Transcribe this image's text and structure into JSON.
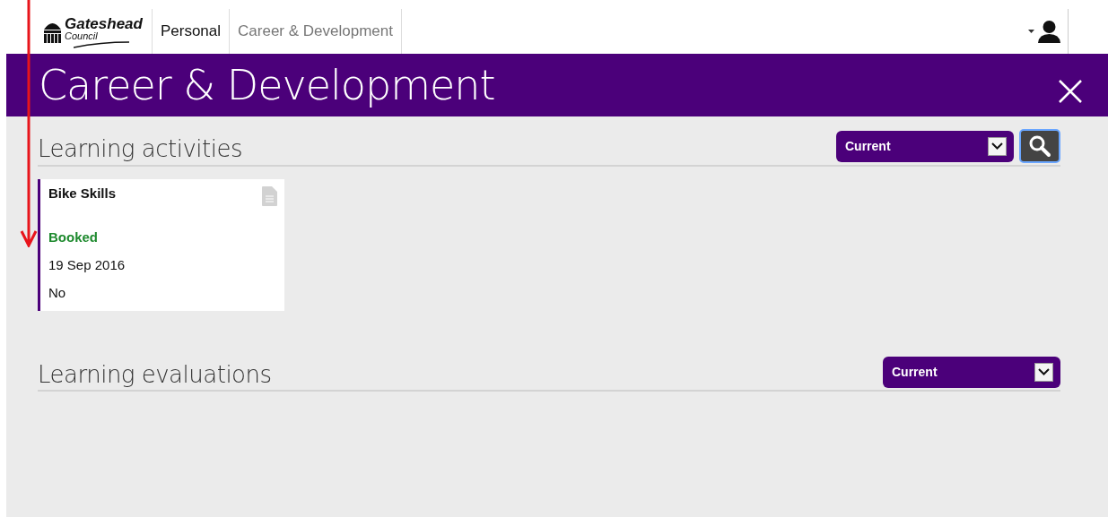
{
  "header": {
    "logo": {
      "name": "Gateshead",
      "subtitle": "Council"
    },
    "tabs": [
      {
        "label": "Personal",
        "selected": true
      },
      {
        "label": "Career & Development",
        "selected": false
      }
    ]
  },
  "banner": {
    "title": "Career & Development"
  },
  "sections": [
    {
      "title": "Learning activities",
      "filter": "Current",
      "search": true,
      "cards": [
        {
          "title": "Bike Skills",
          "status": "Booked",
          "date": "19 Sep 2016",
          "line_3": "No"
        }
      ]
    },
    {
      "title": "Learning evaluations",
      "filter": "Current"
    }
  ]
}
